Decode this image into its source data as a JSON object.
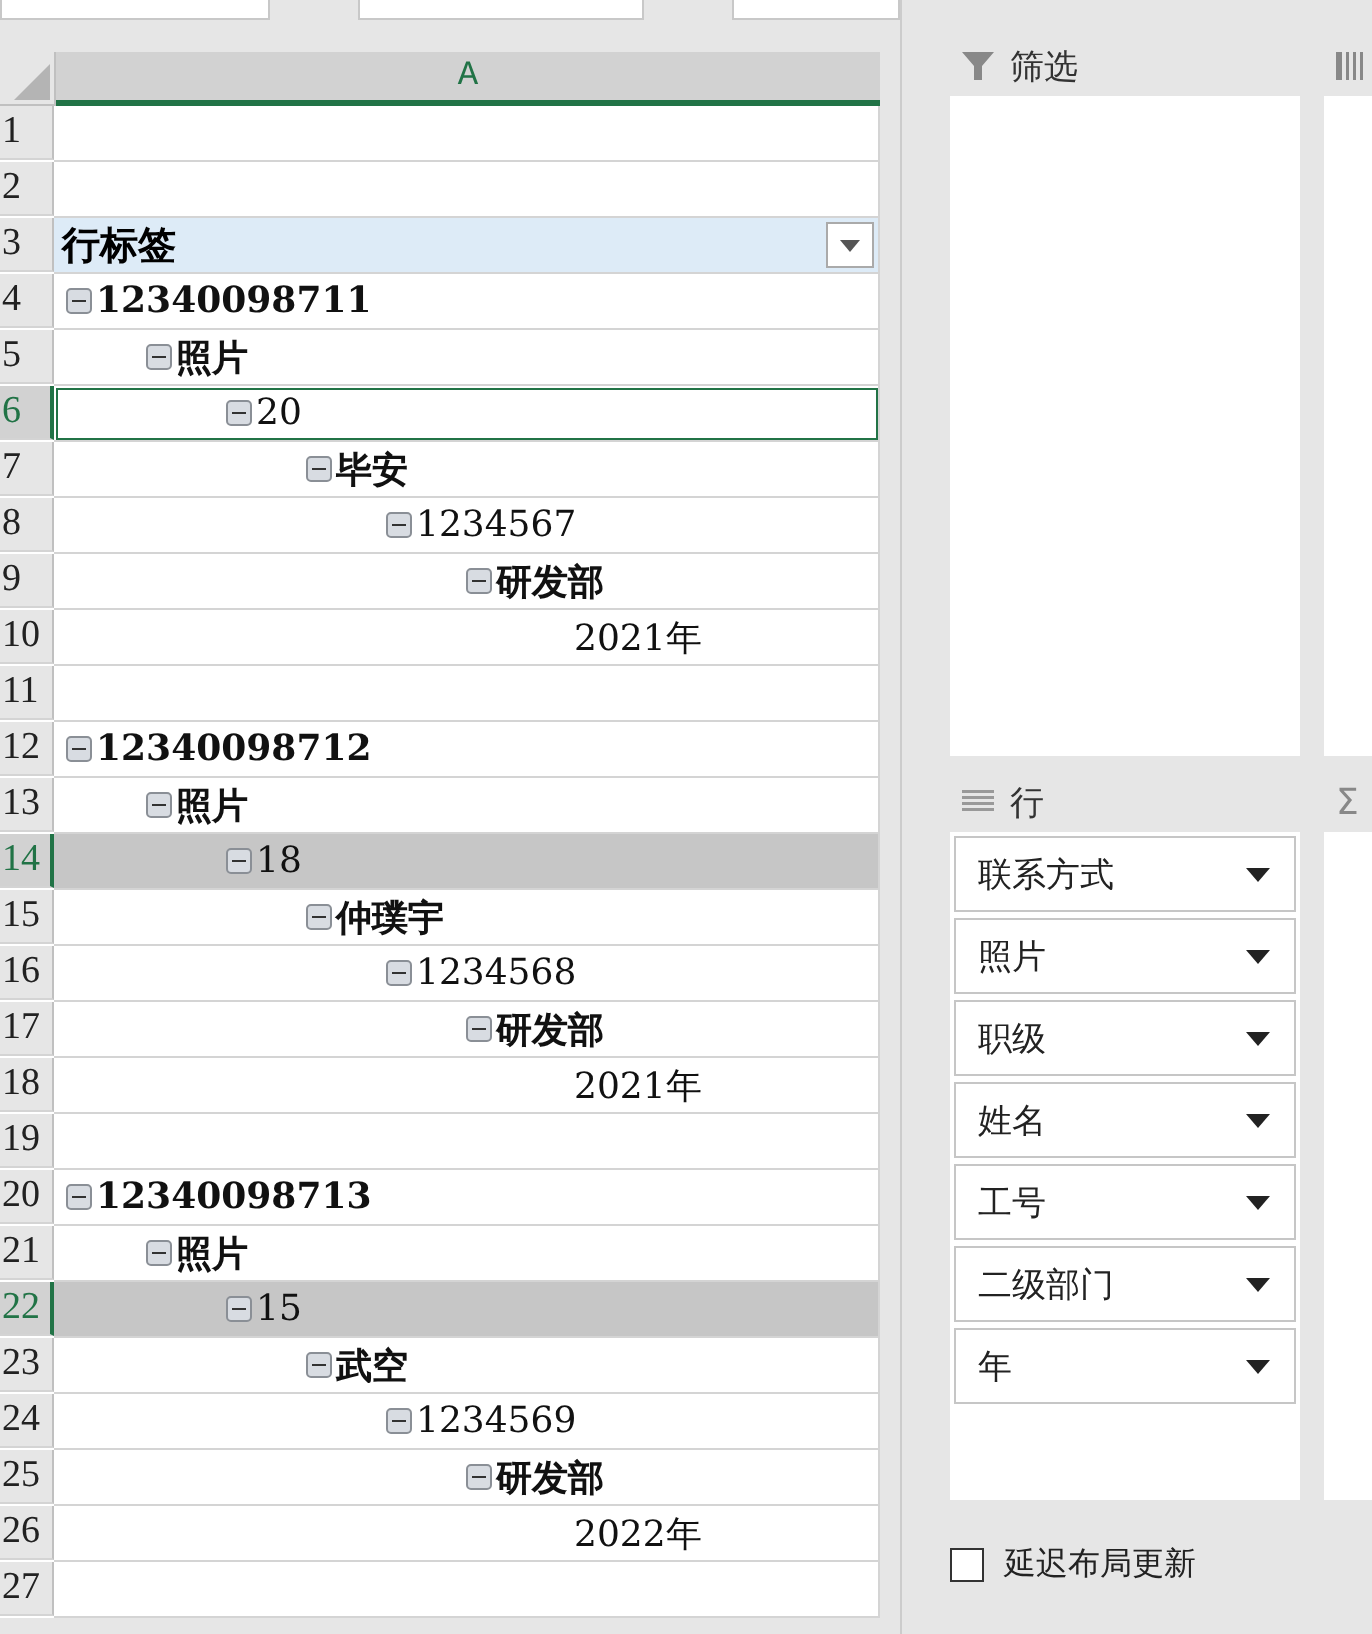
{
  "sheet": {
    "column_header": "A",
    "row_numbers": [
      "1",
      "2",
      "3",
      "4",
      "5",
      "6",
      "7",
      "8",
      "9",
      "10",
      "11",
      "12",
      "13",
      "14",
      "15",
      "16",
      "17",
      "18",
      "19",
      "20",
      "21",
      "22",
      "23",
      "24",
      "25",
      "26",
      "27"
    ]
  },
  "pivot": {
    "header": "行标签",
    "items": [
      {
        "label": "12340098711",
        "bold": true,
        "expanded": true,
        "selected": false,
        "active": false,
        "children": [
          {
            "label": "照片",
            "bold": true,
            "expanded": true,
            "selected": false,
            "active": false,
            "children": [
              {
                "label": "20",
                "bold": false,
                "expanded": true,
                "selected": false,
                "active": true,
                "children": [
                  {
                    "label": "毕安",
                    "bold": true,
                    "expanded": true,
                    "selected": false,
                    "active": false,
                    "children": [
                      {
                        "label": "1234567",
                        "bold": false,
                        "expanded": true,
                        "selected": false,
                        "active": false,
                        "children": [
                          {
                            "label": "研发部",
                            "bold": true,
                            "expanded": true,
                            "selected": false,
                            "active": false,
                            "children": [
                              {
                                "label": "2021年",
                                "bold": false,
                                "selected": false,
                                "active": false
                              }
                            ]
                          }
                        ]
                      }
                    ]
                  }
                ]
              }
            ]
          }
        ]
      },
      {
        "label": "12340098712",
        "bold": true,
        "expanded": true,
        "selected": false,
        "active": false,
        "children": [
          {
            "label": "照片",
            "bold": true,
            "expanded": true,
            "selected": false,
            "active": false,
            "children": [
              {
                "label": "18",
                "bold": false,
                "expanded": true,
                "selected": true,
                "active": false,
                "children": [
                  {
                    "label": "仲璞宇",
                    "bold": true,
                    "expanded": true,
                    "selected": false,
                    "active": false,
                    "children": [
                      {
                        "label": "1234568",
                        "bold": false,
                        "expanded": true,
                        "selected": false,
                        "active": false,
                        "children": [
                          {
                            "label": "研发部",
                            "bold": true,
                            "expanded": true,
                            "selected": false,
                            "active": false,
                            "children": [
                              {
                                "label": "2021年",
                                "bold": false,
                                "selected": false,
                                "active": false
                              }
                            ]
                          }
                        ]
                      }
                    ]
                  }
                ]
              }
            ]
          }
        ]
      },
      {
        "label": "12340098713",
        "bold": true,
        "expanded": true,
        "selected": false,
        "active": false,
        "children": [
          {
            "label": "照片",
            "bold": true,
            "expanded": true,
            "selected": false,
            "active": false,
            "children": [
              {
                "label": "15",
                "bold": false,
                "expanded": true,
                "selected": true,
                "active": false,
                "children": [
                  {
                    "label": "武空",
                    "bold": true,
                    "expanded": true,
                    "selected": false,
                    "active": false,
                    "children": [
                      {
                        "label": "1234569",
                        "bold": false,
                        "expanded": true,
                        "selected": false,
                        "active": false,
                        "children": [
                          {
                            "label": "研发部",
                            "bold": true,
                            "expanded": true,
                            "selected": false,
                            "active": false,
                            "children": [
                              {
                                "label": "2022年",
                                "bold": false,
                                "selected": false,
                                "active": false
                              }
                            ]
                          }
                        ]
                      }
                    ]
                  }
                ]
              }
            ]
          }
        ]
      }
    ]
  },
  "field_panel": {
    "filters": {
      "title": "筛选"
    },
    "rows": {
      "title": "行",
      "fields": [
        "联系方式",
        "照片",
        "职级",
        "姓名",
        "工号",
        "二级部门",
        "年"
      ]
    },
    "values": {
      "icon": "Σ"
    },
    "defer_update": {
      "label": "延迟布局更新",
      "checked": false
    }
  }
}
